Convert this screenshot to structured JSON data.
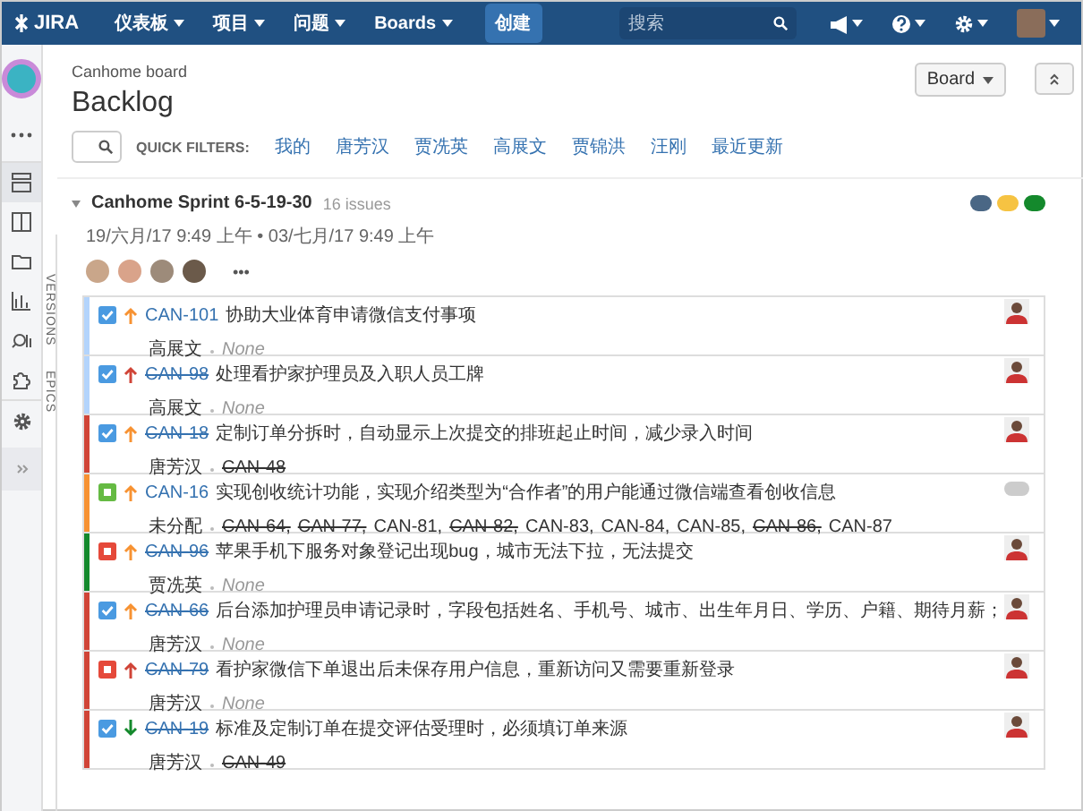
{
  "nav": {
    "logo": "JIRA",
    "menus": [
      {
        "label": "仪表板"
      },
      {
        "label": "项目"
      },
      {
        "label": "问题"
      },
      {
        "label": "Boards"
      }
    ],
    "create": "创建",
    "search": {
      "placeholder": "搜索"
    }
  },
  "sidebar": {
    "items": [
      {
        "kind": "backlog",
        "selected": true
      },
      {
        "kind": "board",
        "selected": false
      },
      {
        "kind": "folder",
        "selected": false
      },
      {
        "kind": "chart",
        "selected": false
      },
      {
        "kind": "search",
        "selected": false
      },
      {
        "kind": "puzzle",
        "selected": false
      }
    ]
  },
  "header": {
    "board": "Canhome board",
    "title": "Backlog",
    "board_button": "Board"
  },
  "quick_filters": {
    "label": "QUICK FILTERS:",
    "items": [
      {
        "label": "我的",
        "selected": false
      },
      {
        "label": "唐芳汉",
        "selected": false
      },
      {
        "label": "贾冼英",
        "selected": false
      },
      {
        "label": "高展文",
        "selected": false
      },
      {
        "label": "贾锦洪",
        "selected": false
      },
      {
        "label": "汪刚",
        "selected": false
      },
      {
        "label": "最近更新",
        "selected": false
      }
    ]
  },
  "side_tabs": [
    "VERSIONS",
    "EPICS"
  ],
  "sprint": {
    "name": "Canhome Sprint 6-5-19-30",
    "count": "16 issues",
    "dates": "19/六月/17 9:49 上午 • 03/七月/17 9:49 上午",
    "status_pills": [
      {
        "color": "#4a6785"
      },
      {
        "color": "#f6c342"
      },
      {
        "color": "#14892c"
      }
    ],
    "more": "•••",
    "issues": [
      {
        "kind": "story",
        "priority": {
          "color": "#f79232",
          "rising": true
        },
        "key": "CAN-101",
        "done": false,
        "summary": "协助大业体育申请微信支付事项",
        "assignee": "高展文",
        "links": [
          {
            "text": "None",
            "kind": "none",
            "done": false
          }
        ],
        "color": "#b3d4fc",
        "unassigned": false
      },
      {
        "kind": "story",
        "priority": {
          "color": "#d04437",
          "rising": true
        },
        "key": "CAN-98",
        "done": true,
        "summary": "处理看护家护理员及入职人员工牌",
        "assignee": "高展文",
        "links": [
          {
            "text": "None",
            "kind": "none",
            "done": false
          }
        ],
        "color": "#b3d4fc",
        "unassigned": false
      },
      {
        "kind": "story",
        "priority": {
          "color": "#f79232",
          "rising": true
        },
        "key": "CAN-18",
        "done": true,
        "summary": "定制订单分拆时，自动显示上次提交的排班起止时间，减少录入时间",
        "assignee": "唐芳汉",
        "links": [
          {
            "text": "CAN-48",
            "kind": "issue",
            "done": true
          }
        ],
        "color": "#d04437",
        "unassigned": false
      },
      {
        "kind": "task",
        "priority": {
          "color": "#f79232",
          "rising": true
        },
        "key": "CAN-16",
        "done": false,
        "summary": "实现创收统计功能，实现介绍类型为“合作者”的用户能通过微信端查看创收信息",
        "assignee": "未分配",
        "links": [
          {
            "text": "CAN-64,",
            "kind": "issue",
            "done": true
          },
          {
            "text": "CAN-77,",
            "kind": "issue",
            "done": true
          },
          {
            "text": "CAN-81,",
            "kind": "issue",
            "done": false
          },
          {
            "text": "CAN-82,",
            "kind": "issue",
            "done": true
          },
          {
            "text": "CAN-83,",
            "kind": "issue",
            "done": false
          },
          {
            "text": "CAN-84,",
            "kind": "issue",
            "done": false
          },
          {
            "text": "CAN-85,",
            "kind": "issue",
            "done": false
          },
          {
            "text": "CAN-86,",
            "kind": "issue",
            "done": true
          },
          {
            "text": "CAN-87",
            "kind": "issue",
            "done": false
          }
        ],
        "color": "#f79232",
        "unassigned": true
      },
      {
        "kind": "bug",
        "priority": {
          "color": "#f79232",
          "rising": true
        },
        "key": "CAN-96",
        "done": true,
        "summary": "苹果手机下服务对象登记出现bug，城市无法下拉，无法提交",
        "assignee": "贾冼英",
        "links": [
          {
            "text": "None",
            "kind": "none",
            "done": false
          }
        ],
        "color": "#14892c",
        "unassigned": false
      },
      {
        "kind": "story",
        "priority": {
          "color": "#f79232",
          "rising": true
        },
        "key": "CAN-66",
        "done": true,
        "summary": "后台添加护理员申请记录时，字段包括姓名、手机号、城市、出生年月日、学历、户籍、期待月薪；",
        "assignee": "唐芳汉",
        "links": [
          {
            "text": "None",
            "kind": "none",
            "done": false
          }
        ],
        "color": "#d04437",
        "unassigned": false
      },
      {
        "kind": "bug",
        "priority": {
          "color": "#d04437",
          "rising": true
        },
        "key": "CAN-79",
        "done": true,
        "summary": "看护家微信下单退出后未保存用户信息，重新访问又需要重新登录",
        "assignee": "唐芳汉",
        "links": [
          {
            "text": "None",
            "kind": "none",
            "done": false
          }
        ],
        "color": "#d04437",
        "unassigned": false
      },
      {
        "kind": "story",
        "priority": {
          "color": "#14892c",
          "rising": false
        },
        "key": "CAN-19",
        "done": true,
        "summary": "标准及定制订单在提交评估受理时，必须填订单来源",
        "assignee": "唐芳汉",
        "links": [
          {
            "text": "CAN-49",
            "kind": "issue",
            "done": true
          }
        ],
        "color": "#d04437",
        "unassigned": false
      }
    ]
  }
}
